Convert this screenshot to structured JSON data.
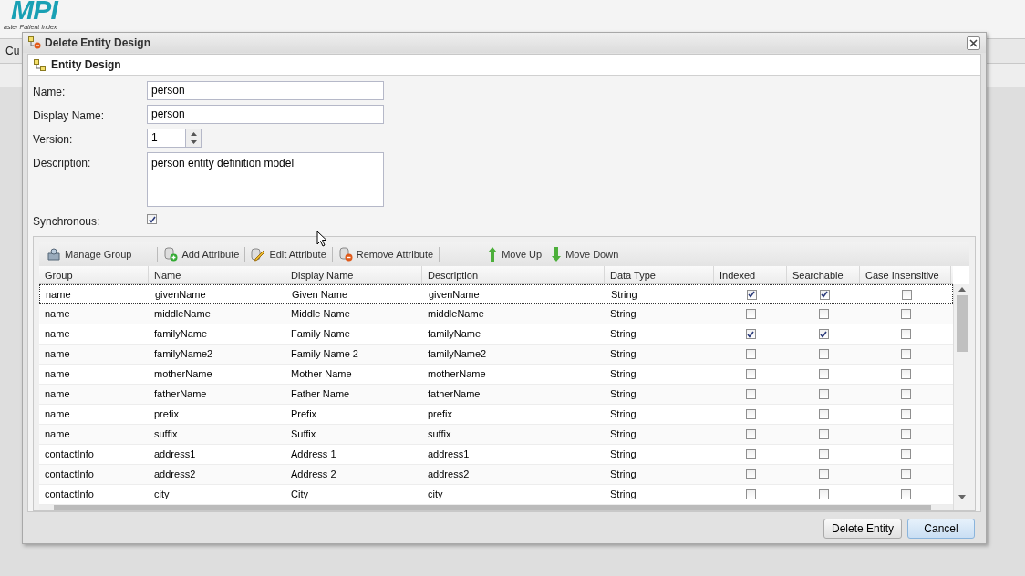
{
  "app": {
    "logo": "MPI",
    "logo_subtitle": "aster Patient Index",
    "menu": [
      "Cu"
    ]
  },
  "dialog": {
    "title": "Delete Entity Design",
    "panel_title": "Entity Design",
    "fields": [
      {
        "kind": "text",
        "label": "Name:",
        "value": "person"
      },
      {
        "kind": "text",
        "label": "Display Name:",
        "value": "person"
      },
      {
        "kind": "spinner",
        "label": "Version:",
        "value": "1"
      },
      {
        "kind": "textarea",
        "label": "Description:",
        "value": "person entity definition model"
      },
      {
        "kind": "checkbox",
        "label": "Synchronous:",
        "checked": true
      }
    ],
    "toolbar": [
      {
        "kind": "group",
        "label": "Manage Group"
      },
      {
        "kind": "add",
        "label": "Add Attribute"
      },
      {
        "kind": "edit",
        "label": "Edit Attribute"
      },
      {
        "kind": "remove",
        "label": "Remove Attribute"
      },
      {
        "kind": "up",
        "label": "Move Up"
      },
      {
        "kind": "down",
        "label": "Move Down"
      }
    ],
    "table": {
      "columns": [
        "Group",
        "Name",
        "Display Name",
        "Description",
        "Data Type",
        "Indexed",
        "Searchable",
        "Case Insensitive"
      ],
      "rows": [
        {
          "group": "name",
          "name": "givenName",
          "display_name": "Given Name",
          "description": "givenName",
          "data_type": "String",
          "indexed": true,
          "searchable": true,
          "case_insensitive": false,
          "selected": true
        },
        {
          "group": "name",
          "name": "middleName",
          "display_name": "Middle Name",
          "description": "middleName",
          "data_type": "String",
          "indexed": false,
          "searchable": false,
          "case_insensitive": false,
          "selected": false
        },
        {
          "group": "name",
          "name": "familyName",
          "display_name": "Family Name",
          "description": "familyName",
          "data_type": "String",
          "indexed": true,
          "searchable": true,
          "case_insensitive": false,
          "selected": false
        },
        {
          "group": "name",
          "name": "familyName2",
          "display_name": "Family Name 2",
          "description": "familyName2",
          "data_type": "String",
          "indexed": false,
          "searchable": false,
          "case_insensitive": false,
          "selected": false
        },
        {
          "group": "name",
          "name": "motherName",
          "display_name": "Mother Name",
          "description": "motherName",
          "data_type": "String",
          "indexed": false,
          "searchable": false,
          "case_insensitive": false,
          "selected": false
        },
        {
          "group": "name",
          "name": "fatherName",
          "display_name": "Father Name",
          "description": "fatherName",
          "data_type": "String",
          "indexed": false,
          "searchable": false,
          "case_insensitive": false,
          "selected": false
        },
        {
          "group": "name",
          "name": "prefix",
          "display_name": "Prefix",
          "description": "prefix",
          "data_type": "String",
          "indexed": false,
          "searchable": false,
          "case_insensitive": false,
          "selected": false
        },
        {
          "group": "name",
          "name": "suffix",
          "display_name": "Suffix",
          "description": "suffix",
          "data_type": "String",
          "indexed": false,
          "searchable": false,
          "case_insensitive": false,
          "selected": false
        },
        {
          "group": "contactInfo",
          "name": "address1",
          "display_name": "Address 1",
          "description": "address1",
          "data_type": "String",
          "indexed": false,
          "searchable": false,
          "case_insensitive": false,
          "selected": false
        },
        {
          "group": "contactInfo",
          "name": "address2",
          "display_name": "Address 2",
          "description": "address2",
          "data_type": "String",
          "indexed": false,
          "searchable": false,
          "case_insensitive": false,
          "selected": false
        },
        {
          "group": "contactInfo",
          "name": "city",
          "display_name": "City",
          "description": "city",
          "data_type": "String",
          "indexed": false,
          "searchable": false,
          "case_insensitive": false,
          "selected": false
        }
      ]
    },
    "buttons": [
      "Delete Entity",
      "Cancel"
    ]
  }
}
